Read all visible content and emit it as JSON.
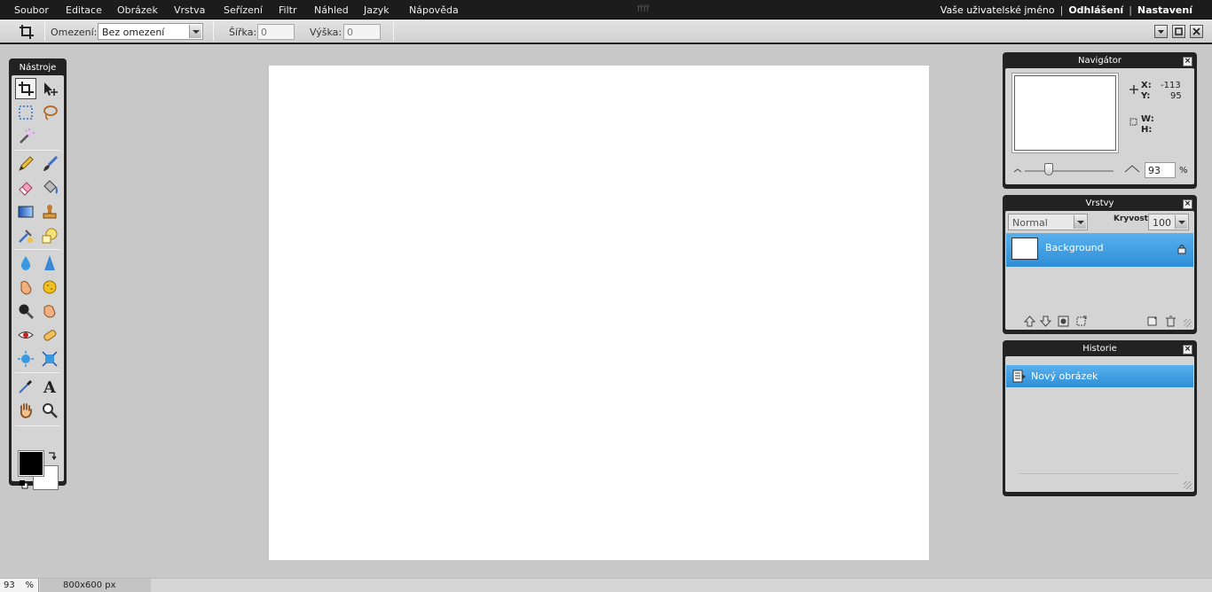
{
  "menubar": {
    "items": [
      "Soubor",
      "Editace",
      "Obrázek",
      "Vrstva",
      "Seřízení",
      "Filtr",
      "Náhled",
      "Jazyk",
      "Nápověda"
    ],
    "doc_title": "ffff",
    "username": "Vaše uživatelské jméno",
    "logout": "Odhlášení",
    "settings": "Nastavení",
    "separator": "|"
  },
  "toolbar": {
    "constraint_label": "Omezení:",
    "constraint_value": "Bez omezení",
    "width_label": "Šířka:",
    "width_value": "0",
    "height_label": "Výška:",
    "height_value": "0"
  },
  "tools": {
    "title": "Nástroje",
    "foreground_color": "#000000",
    "background_color": "#ffffff"
  },
  "navigator": {
    "title": "Navigátor",
    "x_label": "X:",
    "x_value": "-113",
    "y_label": "Y:",
    "y_value": "95",
    "w_label": "W:",
    "h_label": "H:",
    "zoom_value": "93",
    "zoom_unit": "%",
    "zoom_fraction": 0.27
  },
  "layers": {
    "title": "Vrstvy",
    "blend_mode": "Normal",
    "opacity_label": "Kryvost:",
    "opacity_value": "100",
    "items": [
      {
        "name": "Background",
        "locked": true
      }
    ]
  },
  "history": {
    "title": "Historie",
    "items": [
      {
        "name": "Nový obrázek"
      }
    ]
  },
  "statusbar": {
    "zoom": "93",
    "zoom_unit": "%",
    "size": "800x600 px"
  },
  "colors": {
    "accent": "#3a98e0",
    "menubar": "#1c1c1c",
    "workspace": "#c8c8c8"
  }
}
